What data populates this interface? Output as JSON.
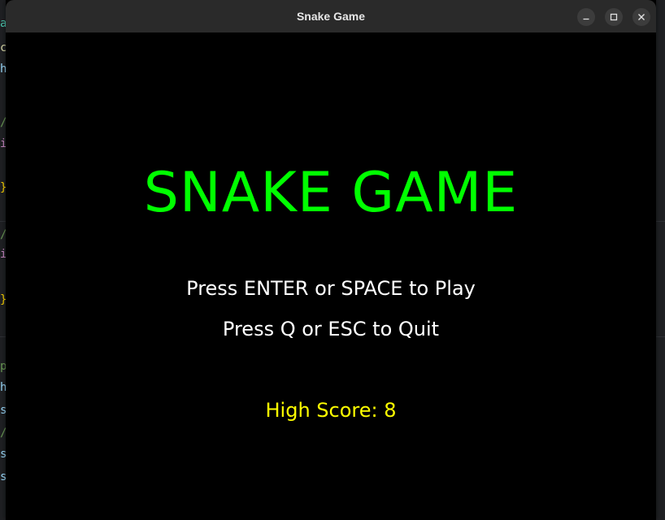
{
  "window": {
    "title": "Snake Game",
    "controls": {
      "minimize": "minimize-icon",
      "maximize": "maximize-icon",
      "close": "close-icon"
    }
  },
  "game": {
    "title": "SNAKE GAME",
    "play_instruction": "Press ENTER or SPACE to Play",
    "quit_instruction": "Press Q or ESC to Quit",
    "high_score_label": "High Score: 8"
  },
  "colors": {
    "title": "#00ff00",
    "instructions": "#ffffff",
    "high_score": "#ffff00",
    "background": "#000000",
    "titlebar": "#2a2a2a"
  }
}
